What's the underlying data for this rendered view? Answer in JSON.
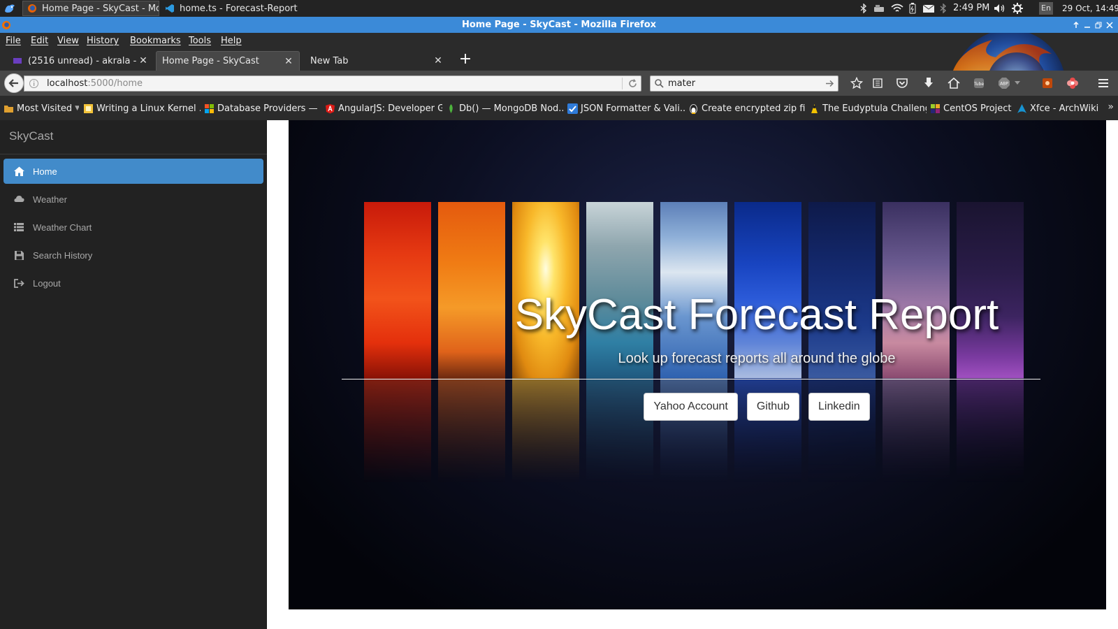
{
  "taskbar": {
    "tasks": [
      {
        "label": "Home Page - SkyCast - Mo..."
      },
      {
        "label": "home.ts - Forecast-Report ..."
      }
    ],
    "time": "2:49 PM",
    "lang": "En",
    "date": "29 Oct, 14:49"
  },
  "window": {
    "title": "Home Page - SkyCast - Mozilla Firefox"
  },
  "menubar": [
    "File",
    "Edit",
    "View",
    "History",
    "Bookmarks",
    "Tools",
    "Help"
  ],
  "tabs": [
    {
      "label": "(2516 unread) - akrala - ..."
    },
    {
      "label": "Home Page - SkyCast"
    },
    {
      "label": "New Tab"
    }
  ],
  "navbar": {
    "url_host": "localhost",
    "url_path": ":5000/home",
    "search_value": "mater"
  },
  "bookmarks": [
    "Most Visited",
    "Writing a Linux Kernel ...",
    "Database Providers — ...",
    "AngularJS: Developer G...",
    "Db() — MongoDB Nod...",
    "JSON Formatter & Vali...",
    "Create encrypted zip fil...",
    "The Eudyptula Challenge",
    "CentOS Project",
    "Xfce - ArchWiki"
  ],
  "sidebar": {
    "brand": "SkyCast",
    "items": [
      {
        "label": "Home",
        "icon": "home-icon",
        "active": true
      },
      {
        "label": "Weather",
        "icon": "cloud-icon"
      },
      {
        "label": "Weather Chart",
        "icon": "list-icon"
      },
      {
        "label": "Search History",
        "icon": "floppy-icon"
      },
      {
        "label": "Logout",
        "icon": "logout-icon"
      }
    ]
  },
  "hero": {
    "title": "SkyCast Forecast Report",
    "subtitle": "Look up forecast reports all around the globe",
    "buttons": [
      "Yahoo Account",
      "Github",
      "Linkedin"
    ]
  },
  "colors": {
    "title_bar": "#3b8ad8",
    "active_nav": "#428bca",
    "sidebar_bg": "#222222",
    "chrome_bg": "#2b2b2b"
  }
}
